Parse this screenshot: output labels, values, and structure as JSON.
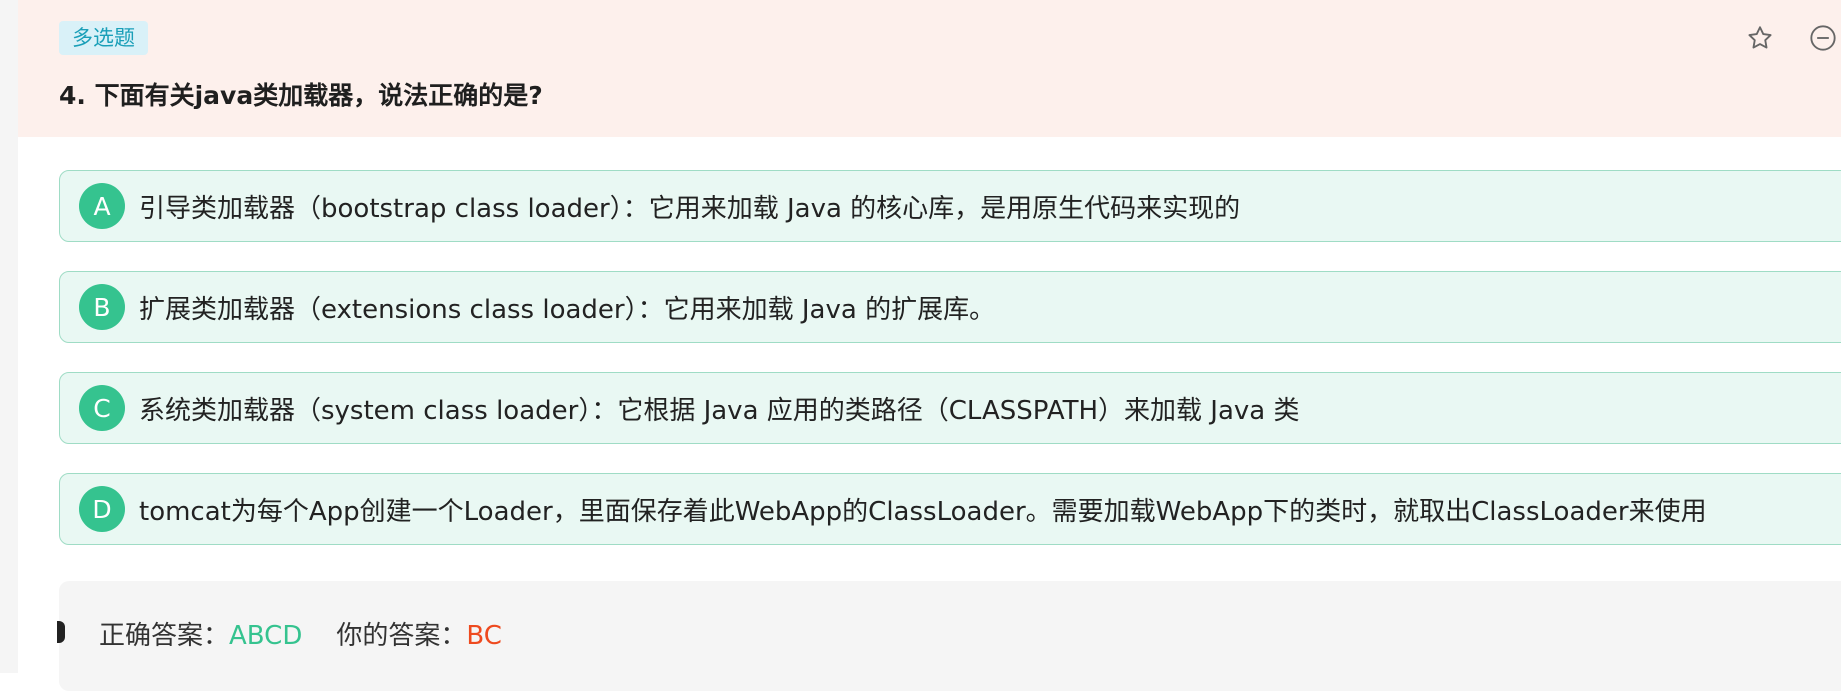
{
  "question": {
    "type_badge": "多选题",
    "title": "4. 下面有关java类加载器，说法正确的是?"
  },
  "header_icons": {
    "favorite": "star-outline-icon",
    "remove": "minus-circle-icon"
  },
  "options": [
    {
      "letter": "A",
      "text": "引导类加载器（bootstrap class loader）：它用来加载 Java 的核心库，是用原生代码来实现的"
    },
    {
      "letter": "B",
      "text": "扩展类加载器（extensions class loader）：它用来加载 Java 的扩展库。"
    },
    {
      "letter": "C",
      "text": "系统类加载器（system class loader）：它根据 Java 应用的类路径（CLASSPATH）来加载 Java 类"
    },
    {
      "letter": "D",
      "text": "tomcat为每个App创建一个Loader，里面保存着此WebApp的ClassLoader。需要加载WebApp下的类时，就取出ClassLoader来使用"
    }
  ],
  "answer": {
    "correct_label": "正确答案：",
    "correct_value": "ABCD",
    "your_label": "你的答案：",
    "your_value": "BC"
  },
  "colors": {
    "header_bg": "#fdf0ec",
    "badge_bg": "#d9f1f8",
    "badge_text": "#1a9fb8",
    "option_bg": "#e9f8f3",
    "option_border": "#9fdcc5",
    "option_letter_bg": "#35c38f",
    "correct": "#35c38f",
    "wrong": "#ee4a1f"
  }
}
